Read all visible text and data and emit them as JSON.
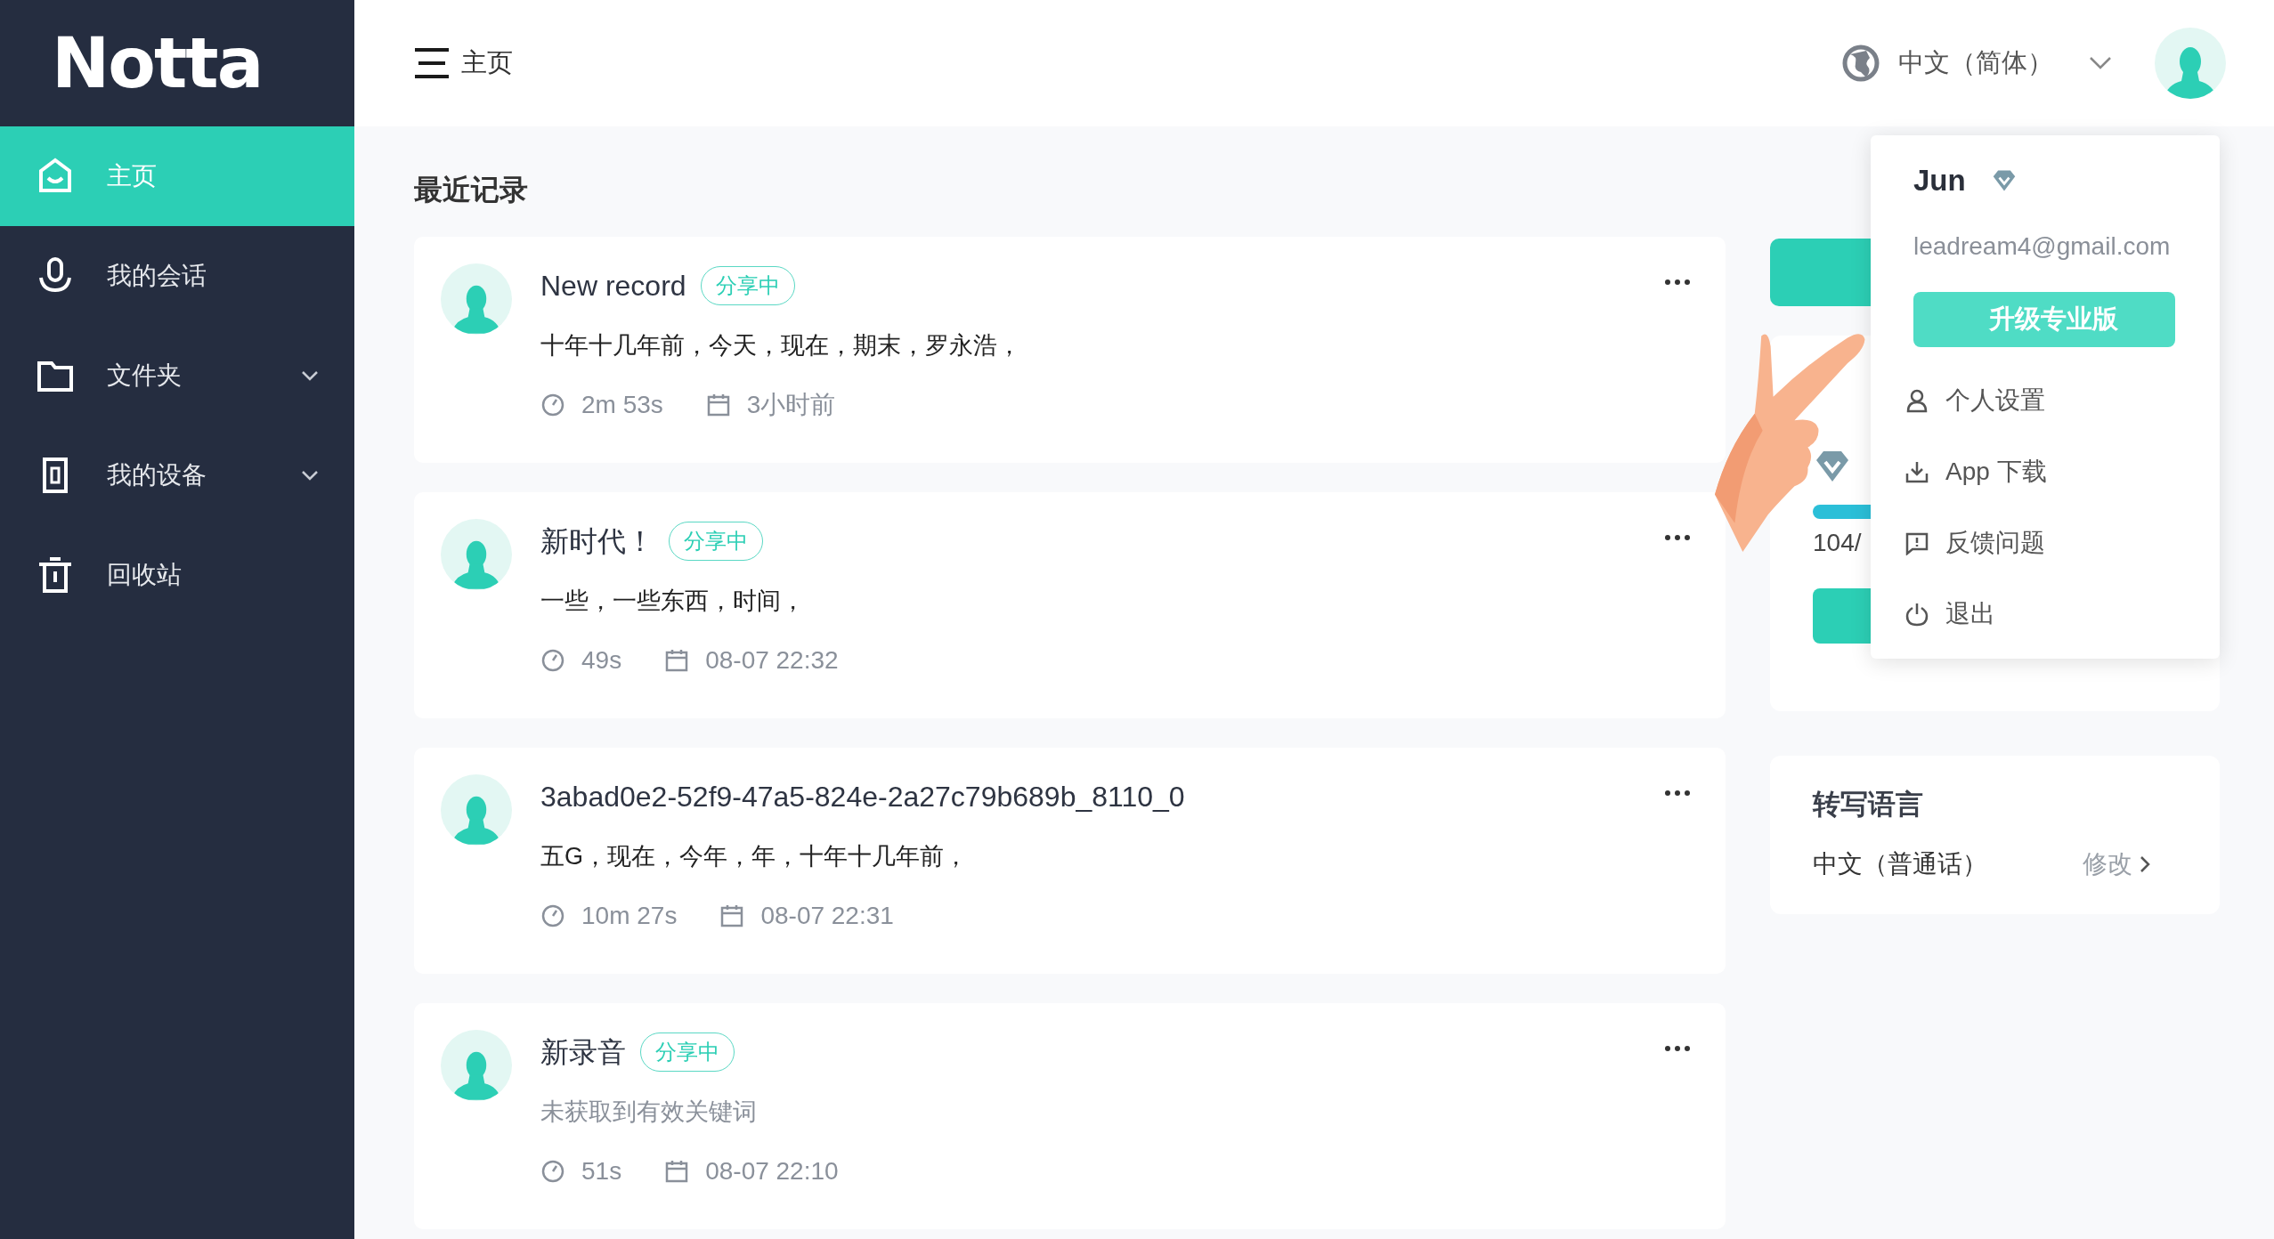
{
  "logo": {
    "text": "Notta"
  },
  "sidebar": {
    "items": [
      {
        "label": "主页",
        "selected": true,
        "expandable": false
      },
      {
        "label": "我的会话",
        "selected": false,
        "expandable": false
      },
      {
        "label": "文件夹",
        "selected": false,
        "expandable": true
      },
      {
        "label": "我的设备",
        "selected": false,
        "expandable": true
      },
      {
        "label": "回收站",
        "selected": false,
        "expandable": false
      }
    ]
  },
  "header": {
    "title": "主页",
    "language": "中文（简体）"
  },
  "main": {
    "heading": "最近记录",
    "records": [
      {
        "title": "New record",
        "badge": "分享中",
        "summary": "十年十几年前，今天，现在，期末，罗永浩，",
        "summary_muted": false,
        "duration": "2m 53s",
        "date": "3小时前"
      },
      {
        "title": "新时代！",
        "badge": "分享中",
        "summary": "一些，一些东西，时间，",
        "summary_muted": false,
        "duration": "49s",
        "date": "08-07 22:32"
      },
      {
        "title": "3abad0e2-52f9-47a5-824e-2a27c79b689b_8110_0",
        "summary": "五G，现在，今年，年，十年十几年前，",
        "summary_muted": false,
        "duration": "10m 27s",
        "date": "08-07 22:31"
      },
      {
        "title": "新录音",
        "badge": "分享中",
        "summary": "未获取到有效关键词",
        "summary_muted": true,
        "duration": "51s",
        "date": "08-07 22:10"
      }
    ]
  },
  "right_panel": {
    "usage": "104/",
    "language_card": {
      "title": "转写语言",
      "value": "中文（普通话）",
      "action": "修改"
    }
  },
  "account_menu": {
    "name": "Jun",
    "email": "leadream4@gmail.com",
    "upgrade": "升级专业版",
    "items": [
      {
        "label": "个人设置"
      },
      {
        "label": "App 下载"
      },
      {
        "label": "反馈问题"
      },
      {
        "label": "退出"
      }
    ]
  }
}
